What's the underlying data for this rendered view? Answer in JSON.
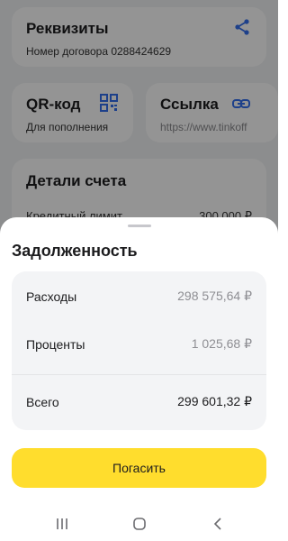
{
  "background": {
    "requisites_card": {
      "title": "Реквизиты",
      "subtitle": "Номер договора 0288424629",
      "icon": "share-icon"
    },
    "qr_card": {
      "title": "QR-код",
      "subtitle": "Для пополнения",
      "icon": "qr-code-icon"
    },
    "link_card": {
      "title": "Ссылка",
      "subtitle": "https://www.tinkoff",
      "icon": "link-icon"
    },
    "details_card": {
      "title": "Детали счета",
      "row_label": "Кредитный лимит",
      "row_value": "300 000 ₽"
    }
  },
  "sheet": {
    "title": "Задолженность",
    "rows": [
      {
        "label": "Расходы",
        "value": "298 575,64 ₽"
      },
      {
        "label": "Проценты",
        "value": "1 025,68 ₽"
      },
      {
        "label": "Всего",
        "value": "299 601,32 ₽"
      }
    ],
    "pay_button": "Погасить"
  },
  "colors": {
    "accent_yellow": "#ffdd2d",
    "icon_blue": "#336fee",
    "dim_overlay": "rgba(0,0,0,0.42)"
  },
  "navbar": {
    "icons": [
      "recents-icon",
      "home-icon",
      "back-icon"
    ]
  }
}
